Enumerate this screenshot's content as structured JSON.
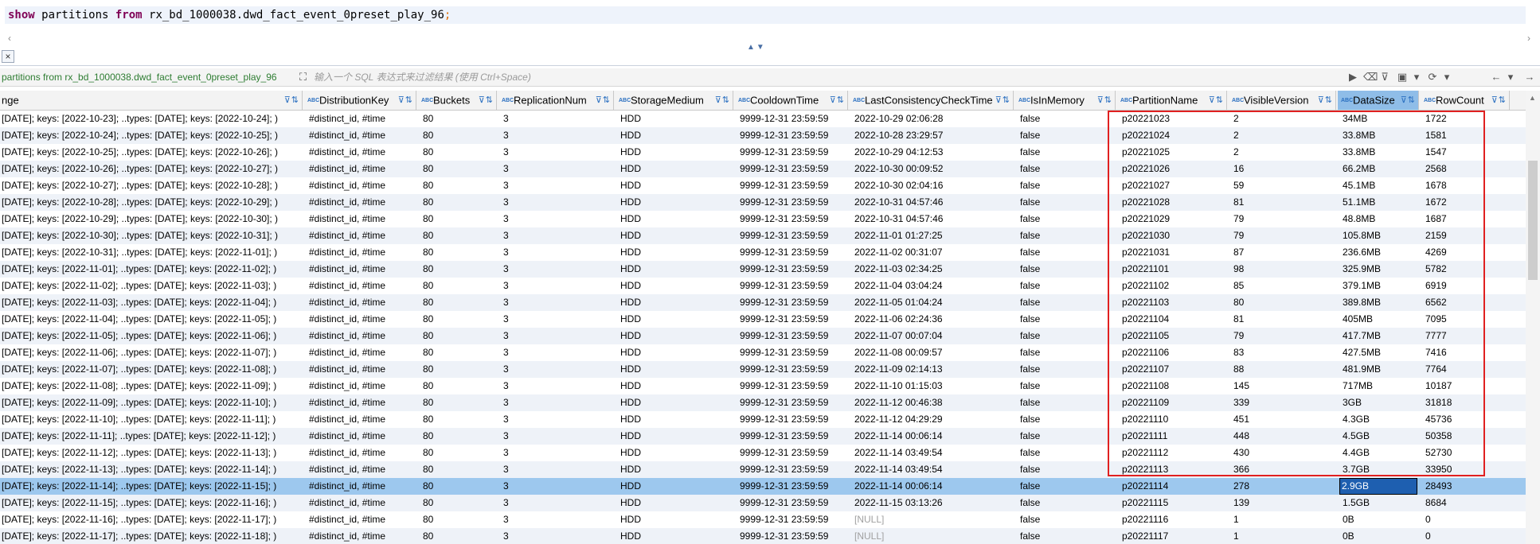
{
  "editor": {
    "kw1": "show",
    "mid1": " partitions ",
    "kw2": "from",
    "mid2": " rx_bd_1000038.dwd_fact_event_0preset_play_96",
    "semi": ";"
  },
  "tabs": {
    "close_label": "×"
  },
  "filter": {
    "query_label": "partitions from rx_bd_1000038.dwd_fact_event_0preset_play_96",
    "placeholder": "输入一个 SQL 表达式来过滤结果 (使用 Ctrl+Space)"
  },
  "columns": [
    {
      "label": "nge",
      "key": "range"
    },
    {
      "label": "DistributionKey",
      "key": "dk"
    },
    {
      "label": "Buckets",
      "key": "buckets"
    },
    {
      "label": "ReplicationNum",
      "key": "rep"
    },
    {
      "label": "StorageMedium",
      "key": "sm"
    },
    {
      "label": "CooldownTime",
      "key": "ct"
    },
    {
      "label": "LastConsistencyCheckTime",
      "key": "lcct"
    },
    {
      "label": "IsInMemory",
      "key": "mem"
    },
    {
      "label": "PartitionName",
      "key": "pn"
    },
    {
      "label": "VisibleVersion",
      "key": "vv"
    },
    {
      "label": "DataSize",
      "key": "ds"
    },
    {
      "label": "RowCount",
      "key": "rc"
    }
  ],
  "header_type_label": "ABC",
  "rows": [
    {
      "range": "[DATE]; keys: [2022-10-23]; ..types: [DATE]; keys: [2022-10-24]; )",
      "dk": "#distinct_id, #time",
      "buckets": "80",
      "rep": "3",
      "sm": "HDD",
      "ct": "9999-12-31 23:59:59",
      "lcct": "2022-10-29 02:06:28",
      "mem": "false",
      "pn": "p20221023",
      "vv": "2",
      "ds": "34MB",
      "rc": "1722"
    },
    {
      "range": "[DATE]; keys: [2022-10-24]; ..types: [DATE]; keys: [2022-10-25]; )",
      "dk": "#distinct_id, #time",
      "buckets": "80",
      "rep": "3",
      "sm": "HDD",
      "ct": "9999-12-31 23:59:59",
      "lcct": "2022-10-28 23:29:57",
      "mem": "false",
      "pn": "p20221024",
      "vv": "2",
      "ds": "33.8MB",
      "rc": "1581"
    },
    {
      "range": "[DATE]; keys: [2022-10-25]; ..types: [DATE]; keys: [2022-10-26]; )",
      "dk": "#distinct_id, #time",
      "buckets": "80",
      "rep": "3",
      "sm": "HDD",
      "ct": "9999-12-31 23:59:59",
      "lcct": "2022-10-29 04:12:53",
      "mem": "false",
      "pn": "p20221025",
      "vv": "2",
      "ds": "33.8MB",
      "rc": "1547"
    },
    {
      "range": "[DATE]; keys: [2022-10-26]; ..types: [DATE]; keys: [2022-10-27]; )",
      "dk": "#distinct_id, #time",
      "buckets": "80",
      "rep": "3",
      "sm": "HDD",
      "ct": "9999-12-31 23:59:59",
      "lcct": "2022-10-30 00:09:52",
      "mem": "false",
      "pn": "p20221026",
      "vv": "16",
      "ds": "66.2MB",
      "rc": "2568"
    },
    {
      "range": "[DATE]; keys: [2022-10-27]; ..types: [DATE]; keys: [2022-10-28]; )",
      "dk": "#distinct_id, #time",
      "buckets": "80",
      "rep": "3",
      "sm": "HDD",
      "ct": "9999-12-31 23:59:59",
      "lcct": "2022-10-30 02:04:16",
      "mem": "false",
      "pn": "p20221027",
      "vv": "59",
      "ds": "45.1MB",
      "rc": "1678"
    },
    {
      "range": "[DATE]; keys: [2022-10-28]; ..types: [DATE]; keys: [2022-10-29]; )",
      "dk": "#distinct_id, #time",
      "buckets": "80",
      "rep": "3",
      "sm": "HDD",
      "ct": "9999-12-31 23:59:59",
      "lcct": "2022-10-31 04:57:46",
      "mem": "false",
      "pn": "p20221028",
      "vv": "81",
      "ds": "51.1MB",
      "rc": "1672"
    },
    {
      "range": "[DATE]; keys: [2022-10-29]; ..types: [DATE]; keys: [2022-10-30]; )",
      "dk": "#distinct_id, #time",
      "buckets": "80",
      "rep": "3",
      "sm": "HDD",
      "ct": "9999-12-31 23:59:59",
      "lcct": "2022-10-31 04:57:46",
      "mem": "false",
      "pn": "p20221029",
      "vv": "79",
      "ds": "48.8MB",
      "rc": "1687"
    },
    {
      "range": "[DATE]; keys: [2022-10-30]; ..types: [DATE]; keys: [2022-10-31]; )",
      "dk": "#distinct_id, #time",
      "buckets": "80",
      "rep": "3",
      "sm": "HDD",
      "ct": "9999-12-31 23:59:59",
      "lcct": "2022-11-01 01:27:25",
      "mem": "false",
      "pn": "p20221030",
      "vv": "79",
      "ds": "105.8MB",
      "rc": "2159"
    },
    {
      "range": "[DATE]; keys: [2022-10-31]; ..types: [DATE]; keys: [2022-11-01]; )",
      "dk": "#distinct_id, #time",
      "buckets": "80",
      "rep": "3",
      "sm": "HDD",
      "ct": "9999-12-31 23:59:59",
      "lcct": "2022-11-02 00:31:07",
      "mem": "false",
      "pn": "p20221031",
      "vv": "87",
      "ds": "236.6MB",
      "rc": "4269"
    },
    {
      "range": "[DATE]; keys: [2022-11-01]; ..types: [DATE]; keys: [2022-11-02]; )",
      "dk": "#distinct_id, #time",
      "buckets": "80",
      "rep": "3",
      "sm": "HDD",
      "ct": "9999-12-31 23:59:59",
      "lcct": "2022-11-03 02:34:25",
      "mem": "false",
      "pn": "p20221101",
      "vv": "98",
      "ds": "325.9MB",
      "rc": "5782"
    },
    {
      "range": "[DATE]; keys: [2022-11-02]; ..types: [DATE]; keys: [2022-11-03]; )",
      "dk": "#distinct_id, #time",
      "buckets": "80",
      "rep": "3",
      "sm": "HDD",
      "ct": "9999-12-31 23:59:59",
      "lcct": "2022-11-04 03:04:24",
      "mem": "false",
      "pn": "p20221102",
      "vv": "85",
      "ds": "379.1MB",
      "rc": "6919"
    },
    {
      "range": "[DATE]; keys: [2022-11-03]; ..types: [DATE]; keys: [2022-11-04]; )",
      "dk": "#distinct_id, #time",
      "buckets": "80",
      "rep": "3",
      "sm": "HDD",
      "ct": "9999-12-31 23:59:59",
      "lcct": "2022-11-05 01:04:24",
      "mem": "false",
      "pn": "p20221103",
      "vv": "80",
      "ds": "389.8MB",
      "rc": "6562"
    },
    {
      "range": "[DATE]; keys: [2022-11-04]; ..types: [DATE]; keys: [2022-11-05]; )",
      "dk": "#distinct_id, #time",
      "buckets": "80",
      "rep": "3",
      "sm": "HDD",
      "ct": "9999-12-31 23:59:59",
      "lcct": "2022-11-06 02:24:36",
      "mem": "false",
      "pn": "p20221104",
      "vv": "81",
      "ds": "405MB",
      "rc": "7095"
    },
    {
      "range": "[DATE]; keys: [2022-11-05]; ..types: [DATE]; keys: [2022-11-06]; )",
      "dk": "#distinct_id, #time",
      "buckets": "80",
      "rep": "3",
      "sm": "HDD",
      "ct": "9999-12-31 23:59:59",
      "lcct": "2022-11-07 00:07:04",
      "mem": "false",
      "pn": "p20221105",
      "vv": "79",
      "ds": "417.7MB",
      "rc": "7777"
    },
    {
      "range": "[DATE]; keys: [2022-11-06]; ..types: [DATE]; keys: [2022-11-07]; )",
      "dk": "#distinct_id, #time",
      "buckets": "80",
      "rep": "3",
      "sm": "HDD",
      "ct": "9999-12-31 23:59:59",
      "lcct": "2022-11-08 00:09:57",
      "mem": "false",
      "pn": "p20221106",
      "vv": "83",
      "ds": "427.5MB",
      "rc": "7416"
    },
    {
      "range": "[DATE]; keys: [2022-11-07]; ..types: [DATE]; keys: [2022-11-08]; )",
      "dk": "#distinct_id, #time",
      "buckets": "80",
      "rep": "3",
      "sm": "HDD",
      "ct": "9999-12-31 23:59:59",
      "lcct": "2022-11-09 02:14:13",
      "mem": "false",
      "pn": "p20221107",
      "vv": "88",
      "ds": "481.9MB",
      "rc": "7764"
    },
    {
      "range": "[DATE]; keys: [2022-11-08]; ..types: [DATE]; keys: [2022-11-09]; )",
      "dk": "#distinct_id, #time",
      "buckets": "80",
      "rep": "3",
      "sm": "HDD",
      "ct": "9999-12-31 23:59:59",
      "lcct": "2022-11-10 01:15:03",
      "mem": "false",
      "pn": "p20221108",
      "vv": "145",
      "ds": "717MB",
      "rc": "10187"
    },
    {
      "range": "[DATE]; keys: [2022-11-09]; ..types: [DATE]; keys: [2022-11-10]; )",
      "dk": "#distinct_id, #time",
      "buckets": "80",
      "rep": "3",
      "sm": "HDD",
      "ct": "9999-12-31 23:59:59",
      "lcct": "2022-11-12 00:46:38",
      "mem": "false",
      "pn": "p20221109",
      "vv": "339",
      "ds": "3GB",
      "rc": "31818"
    },
    {
      "range": "[DATE]; keys: [2022-11-10]; ..types: [DATE]; keys: [2022-11-11]; )",
      "dk": "#distinct_id, #time",
      "buckets": "80",
      "rep": "3",
      "sm": "HDD",
      "ct": "9999-12-31 23:59:59",
      "lcct": "2022-11-12 04:29:29",
      "mem": "false",
      "pn": "p20221110",
      "vv": "451",
      "ds": "4.3GB",
      "rc": "45736"
    },
    {
      "range": "[DATE]; keys: [2022-11-11]; ..types: [DATE]; keys: [2022-11-12]; )",
      "dk": "#distinct_id, #time",
      "buckets": "80",
      "rep": "3",
      "sm": "HDD",
      "ct": "9999-12-31 23:59:59",
      "lcct": "2022-11-14 00:06:14",
      "mem": "false",
      "pn": "p20221111",
      "vv": "448",
      "ds": "4.5GB",
      "rc": "50358"
    },
    {
      "range": "[DATE]; keys: [2022-11-12]; ..types: [DATE]; keys: [2022-11-13]; )",
      "dk": "#distinct_id, #time",
      "buckets": "80",
      "rep": "3",
      "sm": "HDD",
      "ct": "9999-12-31 23:59:59",
      "lcct": "2022-11-14 03:49:54",
      "mem": "false",
      "pn": "p20221112",
      "vv": "430",
      "ds": "4.4GB",
      "rc": "52730"
    },
    {
      "range": "[DATE]; keys: [2022-11-13]; ..types: [DATE]; keys: [2022-11-14]; )",
      "dk": "#distinct_id, #time",
      "buckets": "80",
      "rep": "3",
      "sm": "HDD",
      "ct": "9999-12-31 23:59:59",
      "lcct": "2022-11-14 03:49:54",
      "mem": "false",
      "pn": "p20221113",
      "vv": "366",
      "ds": "3.7GB",
      "rc": "33950"
    },
    {
      "range": "[DATE]; keys: [2022-11-14]; ..types: [DATE]; keys: [2022-11-15]; )",
      "dk": "#distinct_id, #time",
      "buckets": "80",
      "rep": "3",
      "sm": "HDD",
      "ct": "9999-12-31 23:59:59",
      "lcct": "2022-11-14 00:06:14",
      "mem": "false",
      "pn": "p20221114",
      "vv": "278",
      "ds": "2.9GB",
      "rc": "28493",
      "selected": true
    },
    {
      "range": "[DATE]; keys: [2022-11-15]; ..types: [DATE]; keys: [2022-11-16]; )",
      "dk": "#distinct_id, #time",
      "buckets": "80",
      "rep": "3",
      "sm": "HDD",
      "ct": "9999-12-31 23:59:59",
      "lcct": "2022-11-15 03:13:26",
      "mem": "false",
      "pn": "p20221115",
      "vv": "139",
      "ds": "1.5GB",
      "rc": "8684"
    },
    {
      "range": "[DATE]; keys: [2022-11-16]; ..types: [DATE]; keys: [2022-11-17]; )",
      "dk": "#distinct_id, #time",
      "buckets": "80",
      "rep": "3",
      "sm": "HDD",
      "ct": "9999-12-31 23:59:59",
      "lcct": "[NULL]",
      "mem": "false",
      "pn": "p20221116",
      "vv": "1",
      "ds": "0B",
      "rc": "0"
    },
    {
      "range": "[DATE]; keys: [2022-11-17]; ..types: [DATE]; keys: [2022-11-18]; )",
      "dk": "#distinct_id, #time",
      "buckets": "80",
      "rep": "3",
      "sm": "HDD",
      "ct": "9999-12-31 23:59:59",
      "lcct": "[NULL]",
      "mem": "false",
      "pn": "p20221117",
      "vv": "1",
      "ds": "0B",
      "rc": "0"
    }
  ],
  "colors": {
    "highlight_box": "#e02020",
    "selected_row": "#9dc8ee",
    "focus_cell": "#1e5fb0",
    "alt_row": "#eef2f8"
  }
}
